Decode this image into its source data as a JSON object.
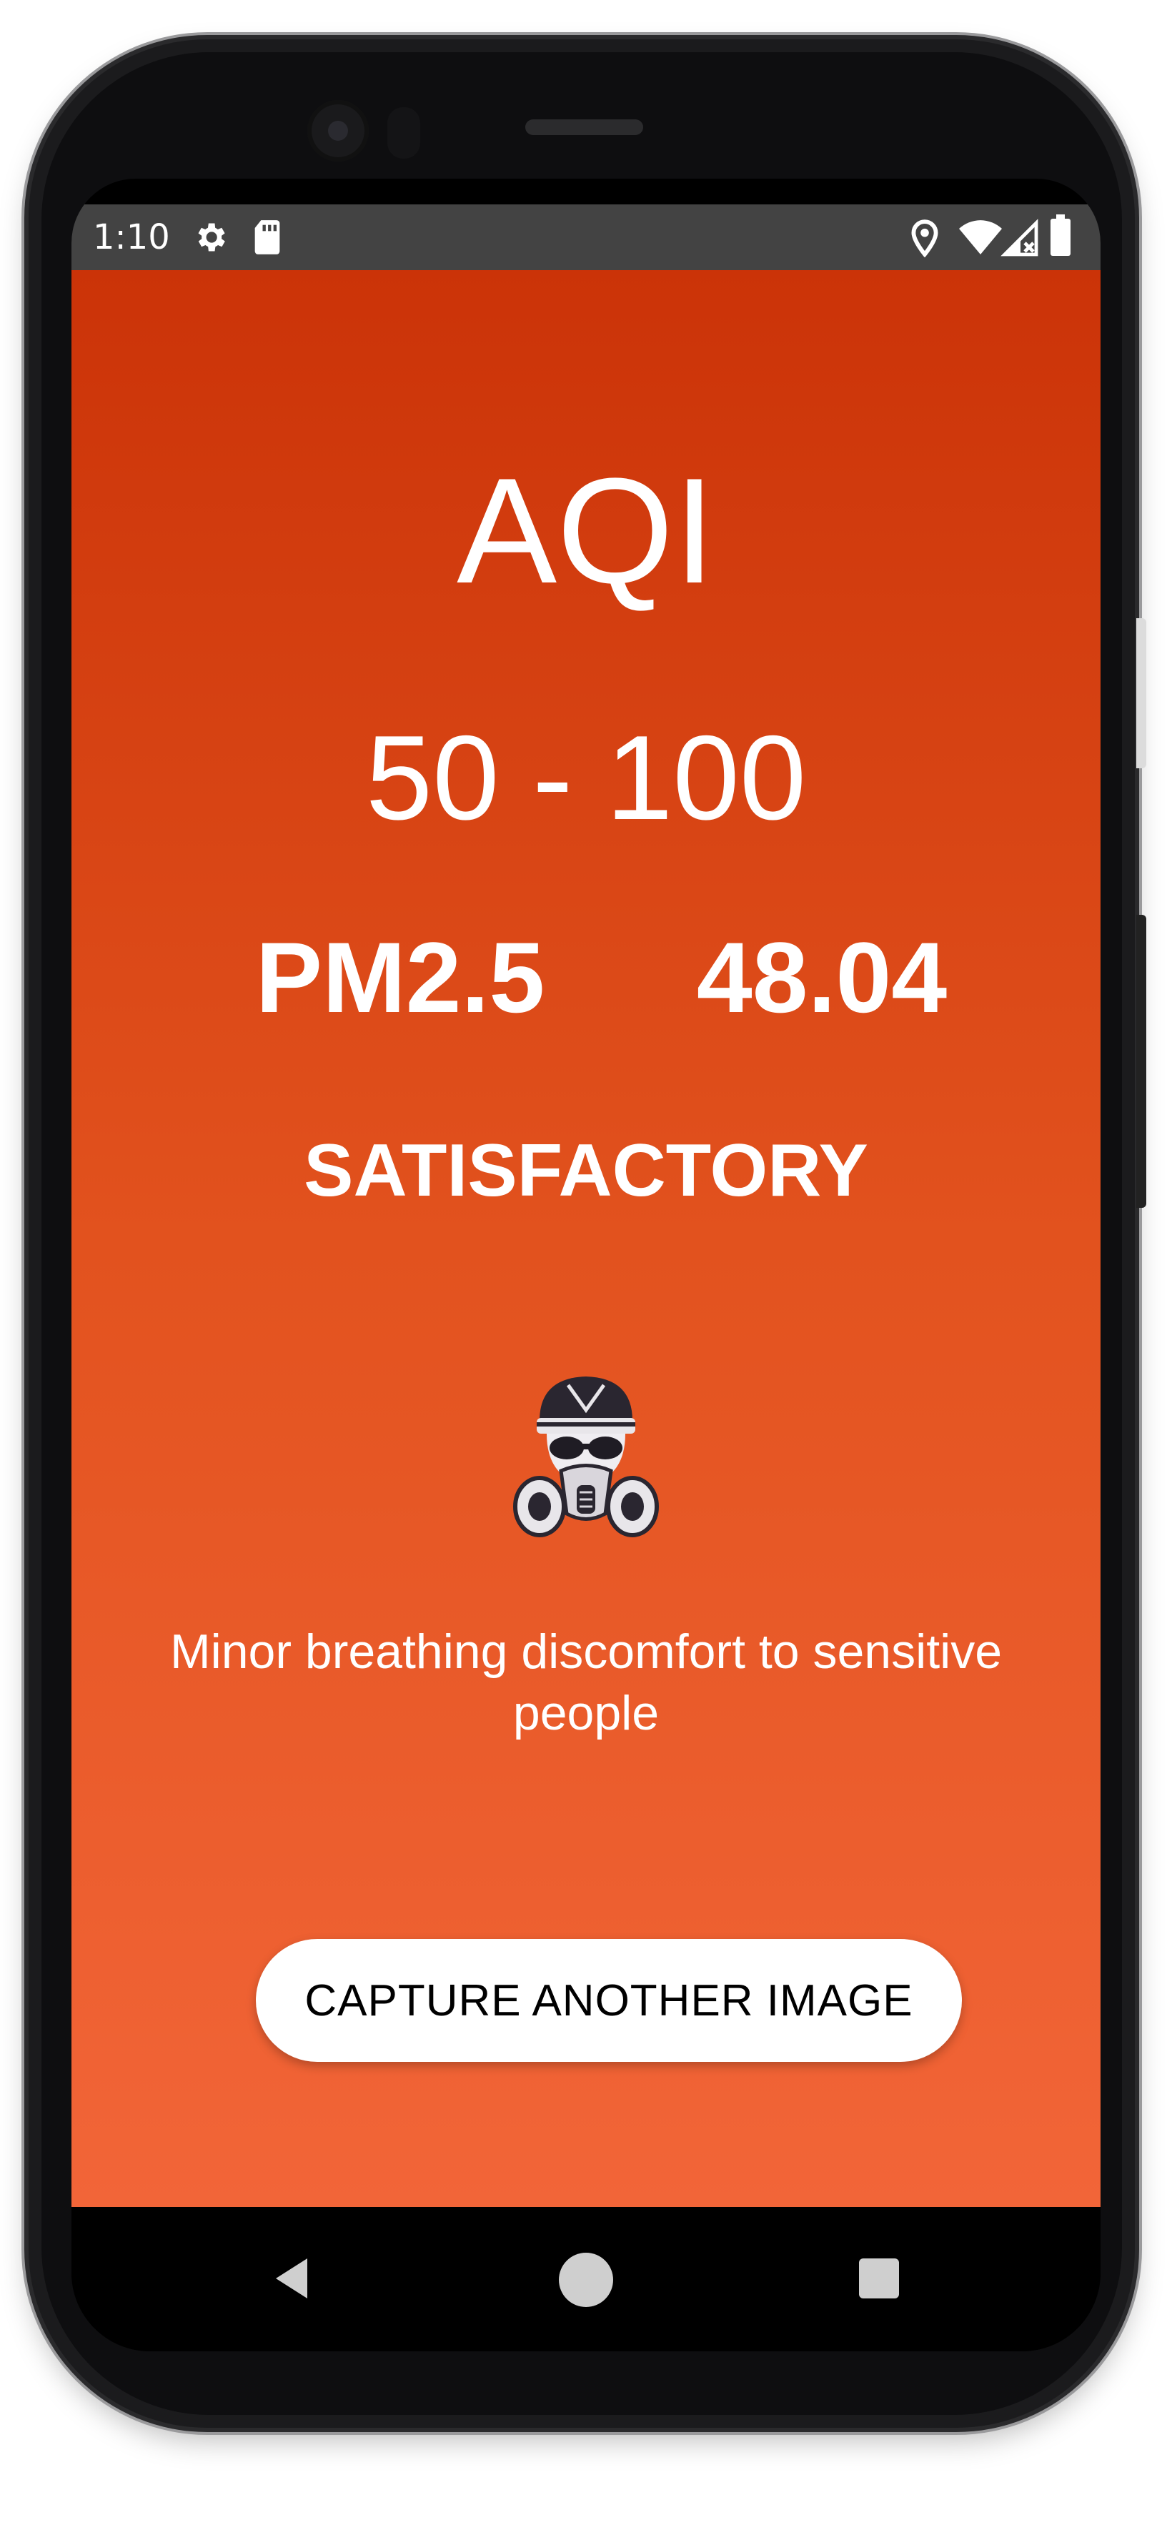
{
  "status_bar": {
    "time": "1:10",
    "icons": [
      "settings-icon",
      "sd-card-icon",
      "location-icon",
      "wifi-icon",
      "signal-icon",
      "battery-icon"
    ]
  },
  "main": {
    "title": "AQI",
    "range": "50 - 100",
    "pm_label": "PM2.5",
    "pm_value": "48.04",
    "category": "SATISFACTORY",
    "message": "Minor breathing discomfort to sensitive people",
    "mascot_icon": "gas-mask-mascot-icon",
    "capture_button_label": "CAPTURE ANOTHER IMAGE"
  },
  "nav_bar": {
    "icons": [
      "back-icon",
      "home-icon",
      "recents-icon"
    ]
  },
  "colors": {
    "gradient_top": "#cb3308",
    "gradient_bottom": "#f26538",
    "status_bar": "#434343",
    "nav_bar": "#000000"
  }
}
